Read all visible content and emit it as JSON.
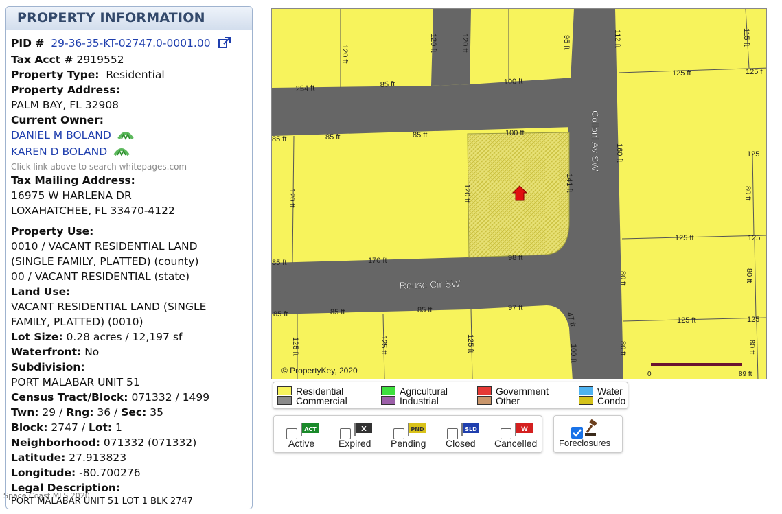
{
  "panel": {
    "title": "PROPERTY INFORMATION",
    "pid_label": "PID #",
    "pid_value": "29-36-35-KT-02747.0-0001.00",
    "tax_acct_label": "Tax Acct #",
    "tax_acct_value": "2919552",
    "property_type_label": "Property Type:",
    "property_type_value": "Residential",
    "property_address_label": "Property Address:",
    "property_address_value": "PALM BAY, FL 32908",
    "current_owner_label": "Current Owner:",
    "owners": [
      "DANIEL M BOLAND",
      "KAREN D BOLAND"
    ],
    "owner_hint": "Click link above to search whitepages.com",
    "mailing_label": "Tax Mailing Address:",
    "mailing_line1": "16975 W HARLENA DR",
    "mailing_line2": "LOXAHATCHEE, FL 33470-4122",
    "property_use_label": "Property Use:",
    "property_use_line1": "0010 / VACANT RESIDENTIAL LAND",
    "property_use_line2": "(SINGLE FAMILY, PLATTED) (county)",
    "property_use_line3": "00 / VACANT RESIDENTIAL (state)",
    "land_use_label": "Land Use:",
    "land_use_line1": "VACANT RESIDENTIAL LAND (SINGLE",
    "land_use_line2": "FAMILY, PLATTED) (0010)",
    "lot_size_label": "Lot Size:",
    "lot_size_value": "0.28 acres / 12,197 sf",
    "waterfront_label": "Waterfront:",
    "waterfront_value": "No",
    "subdivision_label": "Subdivision:",
    "subdivision_value": "PORT MALABAR UNIT 51",
    "census_label": "Census Tract/Block:",
    "census_value": "071332 / 1499",
    "twn_label": "Twn:",
    "twn_value": "29",
    "rng_label": "Rng:",
    "rng_value": "36",
    "sec_label": "Sec:",
    "sec_value": "35",
    "block_label": "Block:",
    "block_value": "2747",
    "lot_label": "Lot:",
    "lot_value": "1",
    "neighborhood_label": "Neighborhood:",
    "neighborhood_value": "071332 (071332)",
    "latitude_label": "Latitude:",
    "latitude_value": "27.913823",
    "longitude_label": "Longitude:",
    "longitude_value": "-80.700276",
    "legal_label": "Legal Description:",
    "legal_value": "PORT MALABAR UNIT 51 LOT 1 BLK 2747"
  },
  "watermark": "Space Coast MLS 2020",
  "map": {
    "copyright": "© PropertyKey, 2020",
    "scale_start": "0",
    "scale_end": "89 ft",
    "street_1": "Rouse Cir SW",
    "street_2": "Colloni Av SW",
    "labels": [
      "120 ft",
      "120 ft",
      "120 ft",
      "95 ft",
      "112 ft",
      "115 ft",
      "254 ft",
      "85 ft",
      "100 ft",
      "125 ft",
      "125 f",
      "85 ft",
      "85 ft",
      "85 ft",
      "100 ft",
      "160 ft",
      "125",
      "120 ft",
      "120 ft",
      "141 ft",
      "80 ft",
      "125 ft",
      "125",
      "85 ft",
      "170 ft",
      "98 ft",
      "80 ft",
      "80 ft",
      "85 ft",
      "85 ft",
      "85 ft",
      "97 ft",
      "47 ft",
      "125 ft",
      "125",
      "125 ft",
      "125 ft",
      "125 ft",
      "100 ft",
      "80 ft",
      "80 ft"
    ]
  },
  "legend": {
    "items": [
      {
        "label": "Residential",
        "color": "#f7f35c"
      },
      {
        "label": "Commercial",
        "color": "#8a8a8a"
      },
      {
        "label": "Agricultural",
        "color": "#3ee03e"
      },
      {
        "label": "Industrial",
        "color": "#9b5fa8"
      },
      {
        "label": "Government",
        "color": "#e53935"
      },
      {
        "label": "Other",
        "color": "#c8956a"
      },
      {
        "label": "Water",
        "color": "#4fb3f0"
      },
      {
        "label": "Condo",
        "color": "#d4c21a"
      }
    ]
  },
  "filters": {
    "items": [
      {
        "label": "Active",
        "code": "ACT",
        "color": "#1a8a2a",
        "checked": false
      },
      {
        "label": "Expired",
        "code": "X",
        "color": "#333333",
        "checked": false
      },
      {
        "label": "Pending",
        "code": "PND",
        "color": "#d9c21a",
        "checked": false
      },
      {
        "label": "Closed",
        "code": "SLD",
        "color": "#1f3fae",
        "checked": false
      },
      {
        "label": "Cancelled",
        "code": "W",
        "color": "#d42020",
        "checked": false
      }
    ],
    "foreclosures_label": "Foreclosures",
    "foreclosures_checked": true
  }
}
